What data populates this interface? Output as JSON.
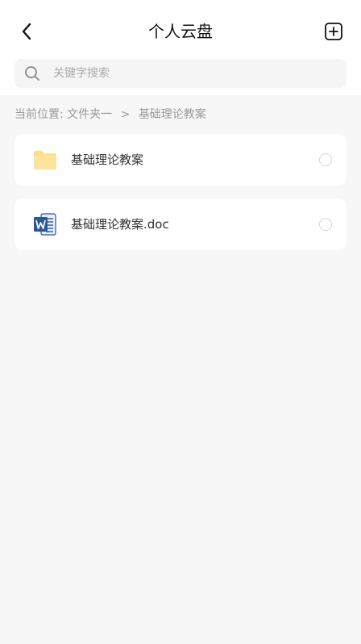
{
  "header": {
    "title": "个人云盘",
    "back_icon": "chevron-left-icon",
    "add_icon": "add-square-icon"
  },
  "search": {
    "placeholder": "关键字搜索",
    "value": "",
    "icon": "search-icon"
  },
  "breadcrumb": {
    "prefix": "当前位置:",
    "parent": "文件夹一",
    "separator": ">",
    "current": "基础理论教案"
  },
  "items": [
    {
      "name": "基础理论教案",
      "type": "folder",
      "icon": "folder-icon",
      "selected": false
    },
    {
      "name": "基础理论教案.doc",
      "type": "word-document",
      "icon": "word-doc-icon",
      "selected": false
    }
  ],
  "colors": {
    "background": "#f7f7f7",
    "folder": "#fddf8a",
    "word": "#2b579a",
    "text": "#333333",
    "muted": "#999999"
  }
}
